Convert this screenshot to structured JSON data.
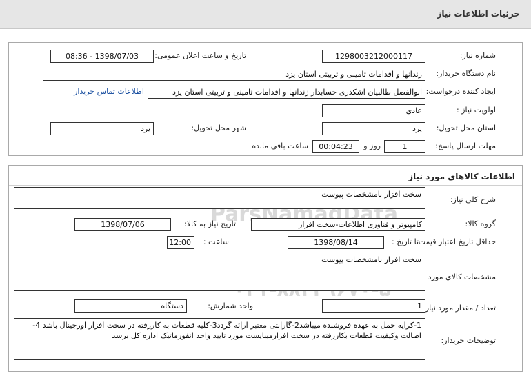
{
  "page_title": "جزئیات اطلاعات نیاز",
  "info": {
    "need_number_label": "شماره نیاز:",
    "need_number": "1298003212000117",
    "announce_label": "تاریخ و ساعت اعلان عمومی:",
    "announce_value": "1398/07/03 - 08:36",
    "buyer_org_label": "نام دستگاه خریدار:",
    "buyer_org": "زندانها و اقدامات تامینی و تربیتی استان یزد",
    "creator_label": "ایجاد کننده درخواست:",
    "creator": "ابوالفضل  طالبیان اشکذری حسابدار زندانها و اقدامات تامینی و تربیتی استان یزد",
    "contact_link": "اطلاعات تماس خریدار",
    "priority_label": "اولویت نیاز :",
    "priority": "عادي",
    "province_label": "استان محل تحویل:",
    "province": "یزد",
    "city_label": "شهر محل تحویل:",
    "city": "یزد",
    "deadline_label": "مهلت ارسال پاسخ:",
    "deadline_days": "1",
    "days_and": "روز و",
    "deadline_time": "00:04:23",
    "remaining": "ساعت باقی مانده"
  },
  "goods": {
    "section_title": "اطلاعات کالاهاي مورد نياز",
    "summary_label": "شرح کلي نياز:",
    "summary": "سخت افزار بامشخصات پیوست",
    "group_label": "گروه کالا:",
    "group": "کامپیوتر و فناوری اطلاعات-سخت افزار",
    "need_date_label": "تاریخ نیاز به کالا:",
    "need_date": "1398/07/06",
    "price_valid_label": "حداقل تاریخ اعتبار قیمت:",
    "to_date_label": "تا تاریخ :",
    "to_date": "1398/08/14",
    "hour_label": "ساعت :",
    "hour": "12:00",
    "spec_label": "مشخصات کالاي مورد نياز:",
    "spec": "سخت افزار بامشخصات پیوست",
    "qty_label": "تعداد / مقدار مورد نیاز:",
    "qty": "1",
    "unit_label": "واحد شمارش:",
    "unit": "دستگاه",
    "desc_label": "توضیحات خریدار:",
    "desc": "1-کرایه حمل به عهده فروشنده میباشد2-گارانتی معتبر ارائه گردد3-کلیه قطعات به کاررفته در سخت افزار اورجینال باشد 4-اصالت وکیفیت قطعات بکاررفته در سخت افزارمیبایست مورد تایید واحد انفورماتیک اداره کل برسد"
  },
  "watermark": {
    "line1": "ParsNamadData",
    "line2": "پایگاه اطلاع رسانی مناقصه ومزایده",
    "line3": "۰۲۱-۸۸۳۴۹۶۷۰-۵"
  }
}
